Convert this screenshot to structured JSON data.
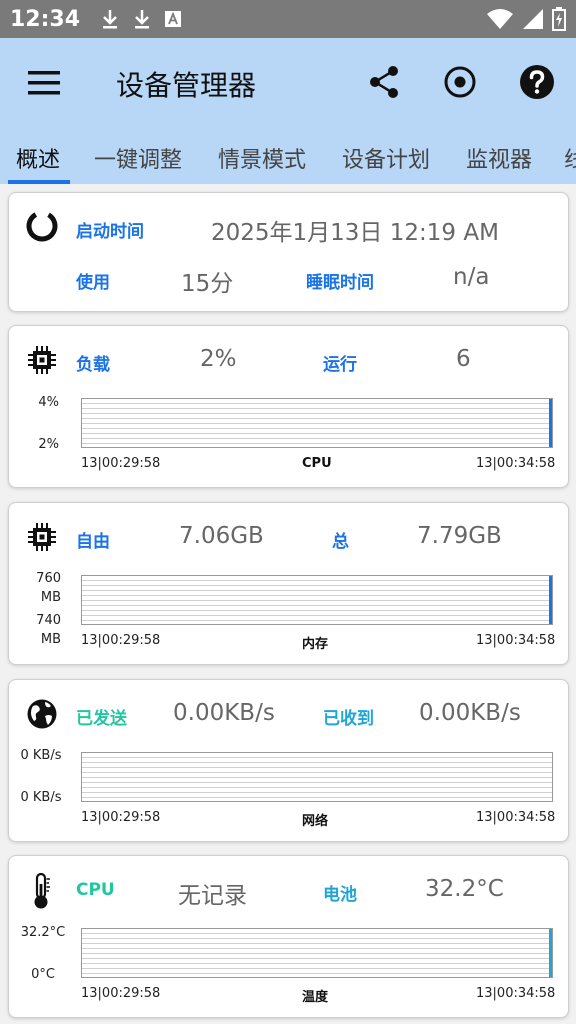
{
  "status_bar": {
    "time": "12:34"
  },
  "app_bar": {
    "title": "设备管理器"
  },
  "tabs": [
    {
      "label": "概述"
    },
    {
      "label": "一键调整"
    },
    {
      "label": "情景模式"
    },
    {
      "label": "设备计划"
    },
    {
      "label": "监视器"
    },
    {
      "label": "线"
    }
  ],
  "boot_card": {
    "boot_label": "启动时间",
    "boot_value": "2025年1月13日 12:19 AM",
    "use_label": "使用",
    "use_value": "15分",
    "sleep_label": "睡眠时间",
    "sleep_value": "n/a"
  },
  "cpu_card": {
    "load_label": "负载",
    "load_value": "2%",
    "run_label": "运行",
    "run_value": "6",
    "y_top": "4%",
    "y_bottom": "2%",
    "time_start": "13|00:29:58",
    "chart_name": "CPU",
    "time_end": "13|00:34:58"
  },
  "mem_card": {
    "free_label": "自由",
    "free_value": "7.06GB",
    "total_label": "总",
    "total_value": "7.79GB",
    "y_top": "760 MB",
    "y_bottom": "740 MB",
    "time_start": "13|00:29:58",
    "chart_name": "内存",
    "time_end": "13|00:34:58"
  },
  "net_card": {
    "sent_label": "已发送",
    "sent_value": "0.00KB/s",
    "recv_label": "已收到",
    "recv_value": "0.00KB/s",
    "y_top": "0 KB/s",
    "y_bottom": "0 KB/s",
    "time_start": "13|00:29:58",
    "chart_name": "网络",
    "time_end": "13|00:34:58"
  },
  "temp_card": {
    "cpu_label": "CPU",
    "cpu_value": "无记录",
    "battery_label": "电池",
    "battery_value": "32.2°C",
    "y_top": "32.2°C",
    "y_bottom": "0°C",
    "time_start": "13|00:29:58",
    "chart_name": "温度",
    "time_end": "13|00:34:58"
  },
  "colors": {
    "app_bar": "#b8d6f6",
    "accent_blue": "#1a73e8",
    "accent_green": "#22c7a0",
    "accent_cyan": "#1fa6d6"
  },
  "icons": {
    "boot": "loading-ring-icon",
    "cpu": "chip-icon",
    "memory": "chip-icon",
    "network": "globe-icon",
    "temperature": "thermometer-icon"
  }
}
